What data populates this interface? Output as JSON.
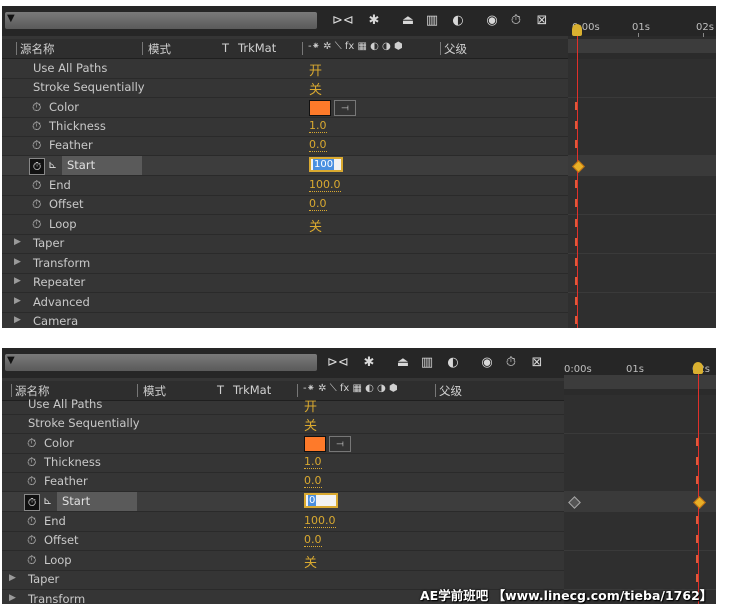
{
  "header": {
    "source_name": "源名称",
    "mode": "模式",
    "t": "T",
    "trkmat": "TrkMat",
    "switches": "-⁕ ✲ ⟍ fx ▦ ◐ ◑ ⬢",
    "parent": "父级"
  },
  "ruler": {
    "top": [
      "0:00s",
      "01s",
      "02s"
    ],
    "bottom": [
      "0:00s",
      "01s",
      "02s"
    ]
  },
  "props": {
    "use_all_paths": "Use All Paths",
    "stroke_sequentially": "Stroke Sequentially",
    "color": "Color",
    "thickness": "Thickness",
    "feather": "Feather",
    "start": "Start",
    "end": "End",
    "offset": "Offset",
    "loop": "Loop",
    "taper": "Taper",
    "transform": "Transform",
    "repeater": "Repeater",
    "advanced": "Advanced",
    "camera": "Camera"
  },
  "values_top": {
    "use_all_paths": "开",
    "stroke_sequentially": "关",
    "thickness": "1.0",
    "feather": "0.0",
    "start": "100",
    "end": "100.0",
    "offset": "0.0",
    "loop": "关"
  },
  "values_bottom": {
    "use_all_paths": "开",
    "stroke_sequentially": "关",
    "thickness": "1.0",
    "feather": "0.0",
    "start": "0",
    "end": "100.0",
    "offset": "0.0",
    "loop": "关"
  },
  "colors": {
    "stroke_color": "#fe7a2a",
    "accent": "#d9a930",
    "cti": "#e0302a"
  },
  "icons": {
    "toolbar": [
      "comp-flow-icon",
      "draft-3d-icon",
      "shy-icon",
      "frame-blend-icon",
      "motion-blur-icon",
      "graph-editor-icon",
      "stopwatch-icon",
      "comp-mini-icon"
    ]
  },
  "watermark": "AE学前班吧 【www.linecg.com/tieba/1762】"
}
